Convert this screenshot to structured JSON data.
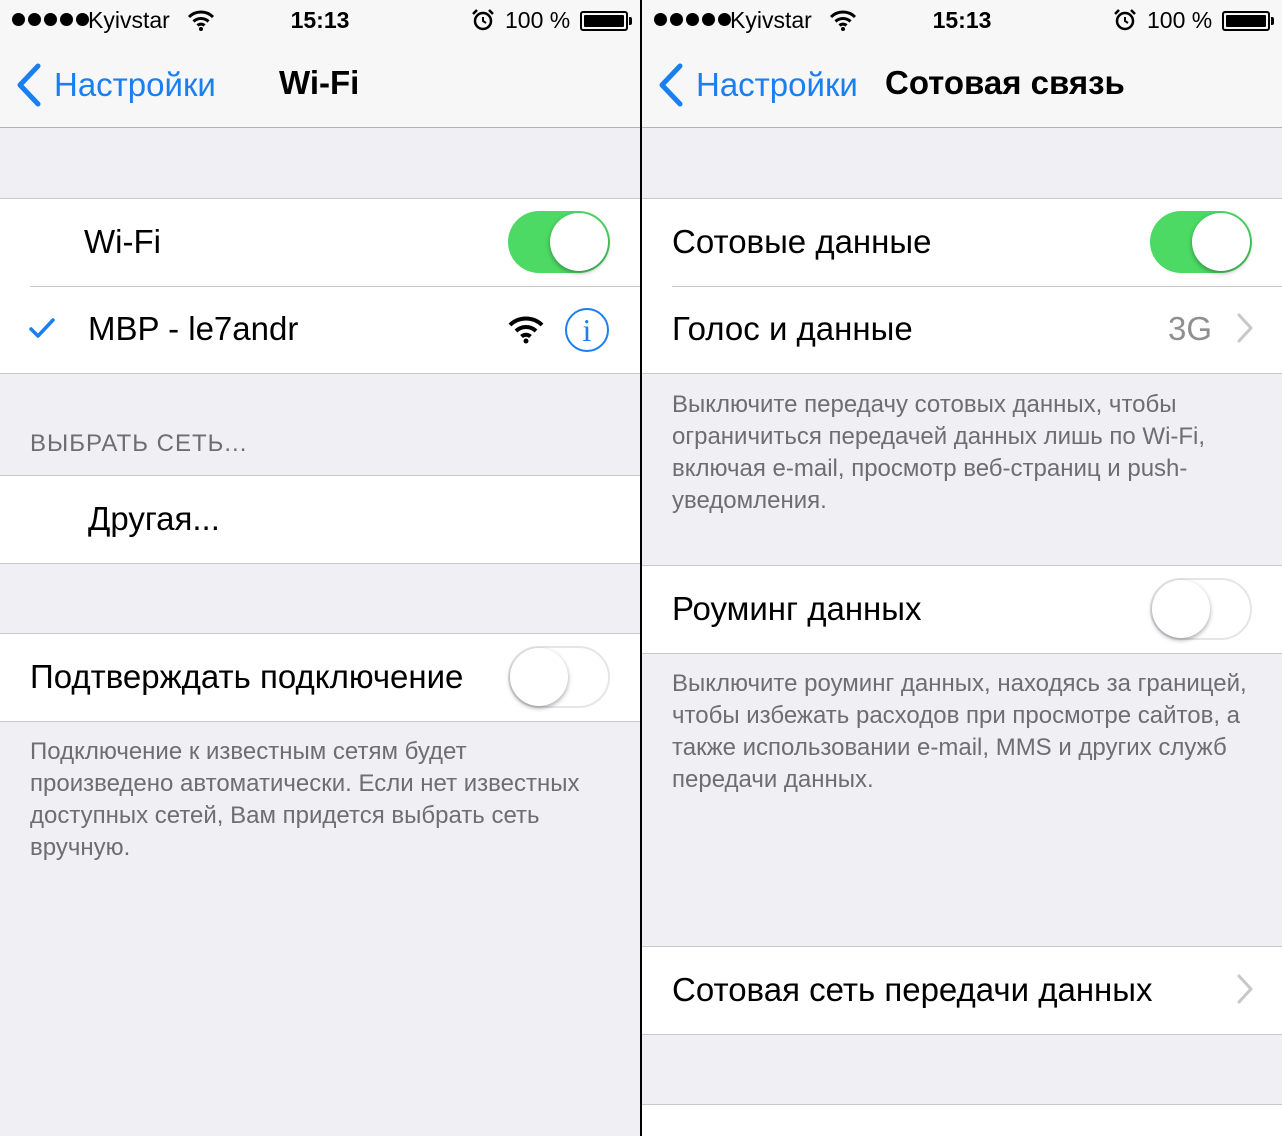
{
  "status_bar": {
    "carrier": "Kyivstar",
    "time": "15:13",
    "battery": "100 %"
  },
  "left": {
    "back_label": "Настройки",
    "title": "Wi-Fi",
    "wifi_label": "Wi-Fi",
    "wifi_on": true,
    "connected_network": "MBP - le7andr",
    "info_symbol": "i",
    "choose_network_header": "ВЫБРАТЬ СЕТЬ...",
    "other_label": "Другая...",
    "ask_join_label": "Подтверждать подключение",
    "ask_join_on": false,
    "ask_join_footer": "Подключение к известным сетям будет произведено автоматически. Если нет известных доступных сетей, Вам придется выбрать сеть вручную."
  },
  "right": {
    "back_label": "Настройки",
    "title": "Сотовая связь",
    "cellular_data_label": "Сотовые данные",
    "cellular_data_on": true,
    "voice_data_label": "Голос и данные",
    "voice_data_value": "3G",
    "cellular_footer": "Выключите передачу сотовых данных, чтобы ограничиться передачей данных лишь по Wi-Fi, включая e-mail, просмотр веб-страниц и push-уведомления.",
    "roaming_label": "Роуминг данных",
    "roaming_on": false,
    "roaming_footer": "Выключите роуминг данных, находясь за границей, чтобы избежать расходов при просмотре сайтов, а также использовании e-mail, MMS и других служб передачи данных.",
    "cellular_network_label": "Сотовая сеть передачи данных"
  },
  "colors": {
    "accent": "#1a7ff0",
    "toggle_on": "#4cd964",
    "background": "#efeff4",
    "secondary_text": "#6d6d72"
  },
  "icons": {
    "signal": "signal-dots-icon",
    "wifi": "wifi-icon",
    "alarm": "alarm-clock-icon",
    "battery": "battery-icon",
    "back": "chevron-left-icon",
    "checkmark": "checkmark-icon",
    "info": "info-icon",
    "disclosure": "chevron-right-icon"
  }
}
